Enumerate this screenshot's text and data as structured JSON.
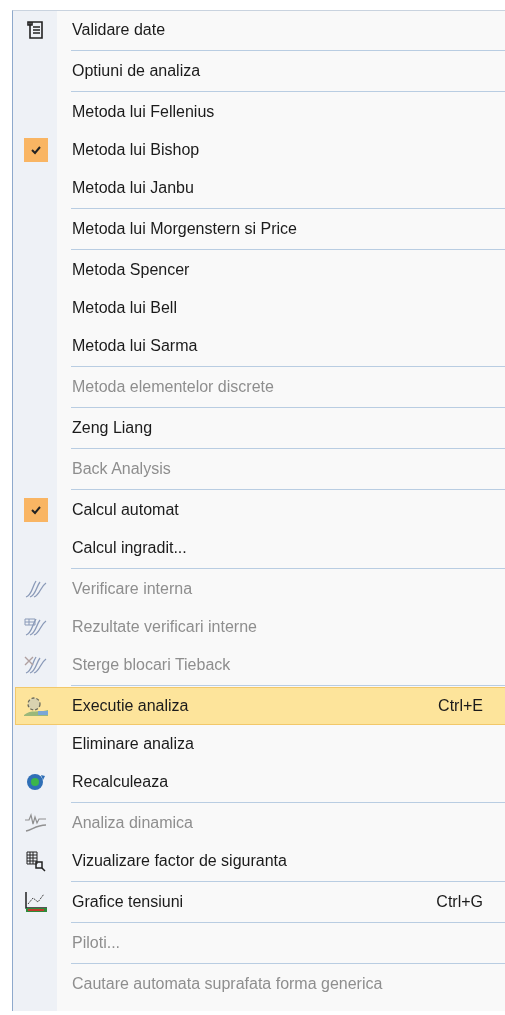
{
  "menu": {
    "items": [
      {
        "kind": "item",
        "label": "Validare date",
        "disabled": false,
        "checked": false,
        "selected": false
      },
      {
        "kind": "separator"
      },
      {
        "kind": "item",
        "label": "Optiuni de analiza",
        "disabled": false,
        "checked": false,
        "selected": false
      },
      {
        "kind": "separator"
      },
      {
        "kind": "item",
        "label": "Metoda lui Fellenius",
        "disabled": false,
        "checked": false,
        "selected": false
      },
      {
        "kind": "item",
        "label": "Metoda lui Bishop",
        "disabled": false,
        "checked": true,
        "selected": false
      },
      {
        "kind": "item",
        "label": "Metoda lui Janbu",
        "disabled": false,
        "checked": false,
        "selected": false
      },
      {
        "kind": "separator"
      },
      {
        "kind": "item",
        "label": "Metoda lui Morgenstern si Price",
        "disabled": false,
        "checked": false,
        "selected": false
      },
      {
        "kind": "separator"
      },
      {
        "kind": "item",
        "label": "Metoda Spencer",
        "disabled": false,
        "checked": false,
        "selected": false
      },
      {
        "kind": "item",
        "label": "Metoda lui Bell",
        "disabled": false,
        "checked": false,
        "selected": false
      },
      {
        "kind": "item",
        "label": "Metoda lui Sarma",
        "disabled": false,
        "checked": false,
        "selected": false
      },
      {
        "kind": "separator"
      },
      {
        "kind": "item",
        "label": "Metoda elementelor discrete",
        "disabled": true,
        "checked": false,
        "selected": false
      },
      {
        "kind": "separator"
      },
      {
        "kind": "item",
        "label": "Zeng Liang",
        "disabled": false,
        "checked": false,
        "selected": false
      },
      {
        "kind": "separator"
      },
      {
        "kind": "item",
        "label": "Back Analysis",
        "disabled": true,
        "checked": false,
        "selected": false
      },
      {
        "kind": "separator"
      },
      {
        "kind": "item",
        "label": "Calcul automat",
        "disabled": false,
        "checked": true,
        "selected": false
      },
      {
        "kind": "item",
        "label": "Calcul ingradit...",
        "disabled": false,
        "checked": false,
        "selected": false
      },
      {
        "kind": "separator"
      },
      {
        "kind": "item",
        "label": "Verificare interna",
        "disabled": true,
        "checked": false,
        "selected": false
      },
      {
        "kind": "item",
        "label": "Rezultate verificari interne",
        "disabled": true,
        "checked": false,
        "selected": false
      },
      {
        "kind": "item",
        "label": "Sterge blocari Tieback",
        "disabled": true,
        "checked": false,
        "selected": false
      },
      {
        "kind": "separator"
      },
      {
        "kind": "item",
        "label": "Executie analiza",
        "shortcut": "Ctrl+E",
        "disabled": false,
        "checked": false,
        "selected": true
      },
      {
        "kind": "item",
        "label": "Eliminare analiza",
        "disabled": false,
        "checked": false,
        "selected": false
      },
      {
        "kind": "item",
        "label": "Recalculeaza",
        "disabled": false,
        "checked": false,
        "selected": false
      },
      {
        "kind": "separator"
      },
      {
        "kind": "item",
        "label": "Analiza dinamica",
        "disabled": true,
        "checked": false,
        "selected": false
      },
      {
        "kind": "item",
        "label": "Vizualizare factor de siguranta",
        "disabled": false,
        "checked": false,
        "selected": false
      },
      {
        "kind": "separator"
      },
      {
        "kind": "item",
        "label": "Grafice tensiuni",
        "shortcut": "Ctrl+G",
        "disabled": false,
        "checked": false,
        "selected": false
      },
      {
        "kind": "separator"
      },
      {
        "kind": "item",
        "label": "Piloti...",
        "disabled": true,
        "checked": false,
        "selected": false
      },
      {
        "kind": "separator"
      },
      {
        "kind": "item",
        "label": "Cautare automata suprafata forma generica",
        "disabled": true,
        "checked": false,
        "selected": false
      }
    ]
  }
}
